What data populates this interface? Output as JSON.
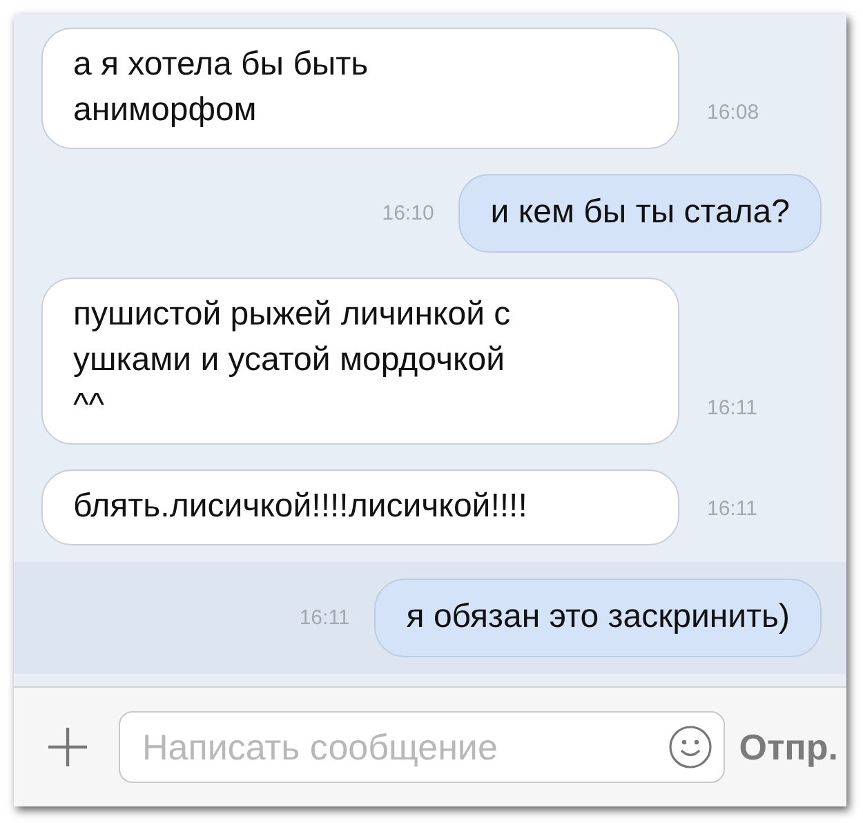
{
  "messages": [
    {
      "kind": "incoming",
      "text": "а я хотела бы быть\nаниморфом",
      "time": "16:08",
      "highlighted": false
    },
    {
      "kind": "outgoing",
      "text": "и кем бы ты стала?",
      "time": "16:10",
      "highlighted": false
    },
    {
      "kind": "incoming",
      "text": "пушистой рыжей личинкой с\nушками и усатой мордочкой\n^^",
      "time": "16:11",
      "highlighted": false
    },
    {
      "kind": "incoming",
      "text": "блять.лисичкой!!!!лисичкой!!!!",
      "time": "16:11",
      "highlighted": false
    },
    {
      "kind": "outgoing",
      "text": "я обязан это заскринить)",
      "time": "16:11",
      "highlighted": true
    }
  ],
  "composer": {
    "placeholder": "Написать сообщение",
    "send_label": "Отпр."
  }
}
